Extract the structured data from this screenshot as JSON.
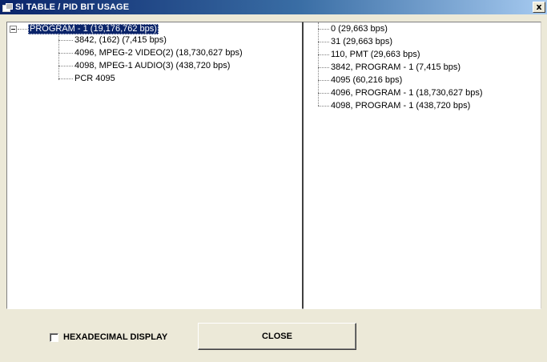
{
  "window": {
    "title": "SI TABLE / PID BIT USAGE",
    "close_glyph": "x"
  },
  "left_tree": {
    "root_label": "PROGRAM - 1 (19,176,762 bps)",
    "children": [
      "3842, (162) (7,415 bps)",
      "4096, MPEG-2 VIDEO(2) (18,730,627 bps)",
      "4098, MPEG-1 AUDIO(3) (438,720 bps)",
      "PCR 4095"
    ]
  },
  "right_tree": {
    "items": [
      "0 (29,663 bps)",
      "31 (29,663 bps)",
      "110, PMT (29,663 bps)",
      "3842, PROGRAM - 1 (7,415 bps)",
      "4095 (60,216 bps)",
      "4096, PROGRAM - 1 (18,730,627 bps)",
      "4098, PROGRAM - 1 (438,720 bps)"
    ]
  },
  "footer": {
    "hex_label": "HEXADECIMAL DISPLAY",
    "hex_checked": false,
    "close_label": "CLOSE"
  },
  "colors": {
    "selection": "#0a246a",
    "dialog_bg": "#ece9d8",
    "title_gradient_start": "#0a246a"
  }
}
